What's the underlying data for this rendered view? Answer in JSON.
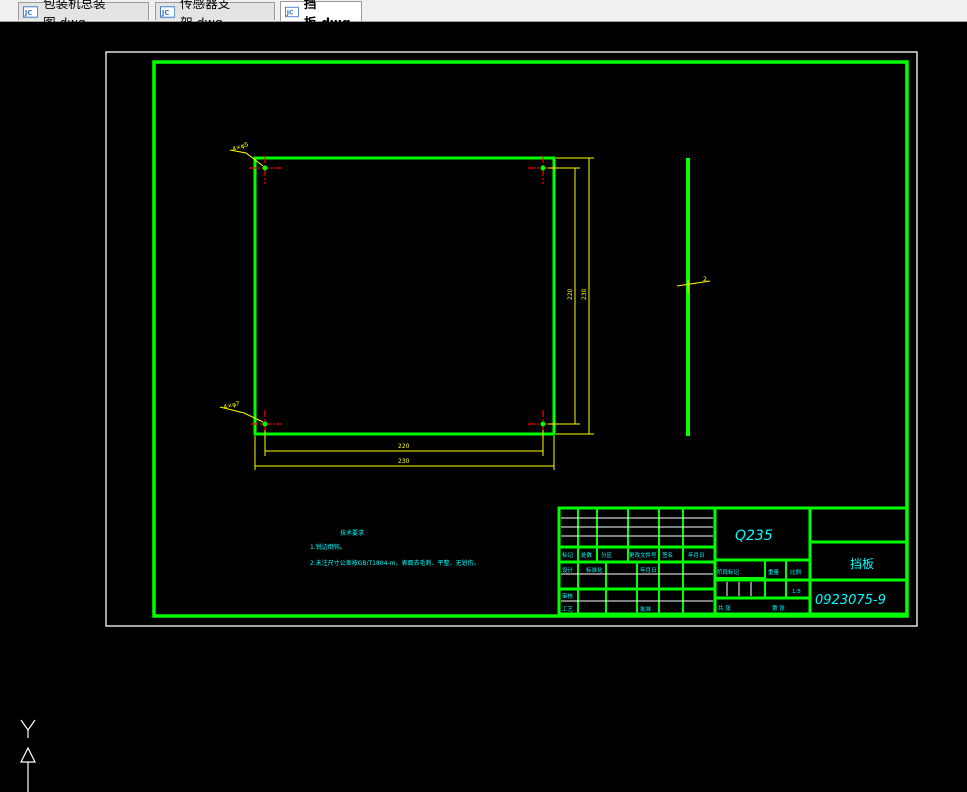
{
  "tabs": [
    {
      "label": "包装机总装图.dwg",
      "active": false
    },
    {
      "label": "传感器支架.dwg",
      "active": false
    },
    {
      "label": "挡板.dwg",
      "active": true
    }
  ],
  "drawing": {
    "dimensions": {
      "bottom_inner": "220",
      "bottom_outer": "230",
      "right_inner": "220",
      "right_outer": "230",
      "hole_top": "4×φ5",
      "hole_bottom": "4×φ7",
      "thickness": "2"
    },
    "notes": {
      "title": "技术要求",
      "line1": "1.锐边倒钝。",
      "line2": "2.未注尺寸公差按GB/T1804-m，表面去毛刺、平整、无划伤。"
    },
    "title_block": {
      "material": "Q235",
      "part_name": "挡板",
      "drawing_no": "0923075-9",
      "scale": "1:5",
      "labels": {
        "mark": "标记",
        "count": "处数",
        "zone": "分区",
        "change_doc": "更改文件号",
        "signature": "签名",
        "date": "年月日",
        "designer": "设计",
        "standardize": "标准化",
        "stage_mark": "阶段标记",
        "weight": "重量",
        "ratio": "比例",
        "review": "审核",
        "process": "工艺",
        "approve": "批准",
        "total_sheets": "共 张",
        "sheet_no": "第 张"
      }
    }
  }
}
